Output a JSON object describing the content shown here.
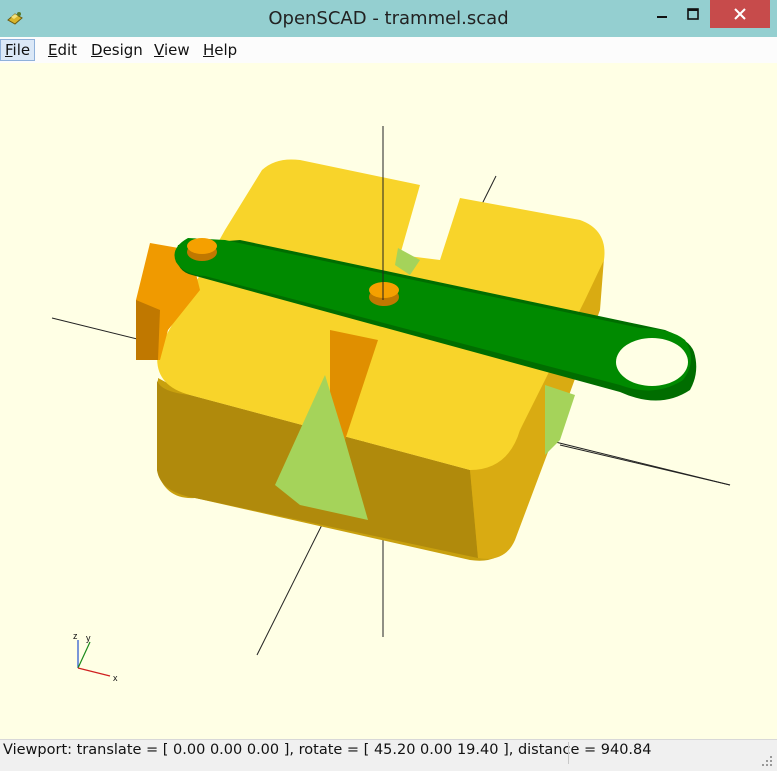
{
  "window": {
    "title": "OpenSCAD - trammel.scad"
  },
  "menu": {
    "items": [
      {
        "label": "File",
        "key": "F",
        "rest": "ile"
      },
      {
        "label": "Edit",
        "key": "E",
        "rest": "dit"
      },
      {
        "label": "Design",
        "key": "D",
        "rest": "esign"
      },
      {
        "label": "View",
        "key": "V",
        "rest": "iew"
      },
      {
        "label": "Help",
        "key": "H",
        "rest": "elp"
      }
    ]
  },
  "axes_gizmo": {
    "z": "z",
    "y": "y",
    "x": "x"
  },
  "status": {
    "text": "Viewport: translate = [ 0.00 0.00 0.00 ], rotate = [ 45.20 0.00 19.40 ], distance = 940.84"
  },
  "colors": {
    "titlebar": "#94cfd0",
    "close": "#c74b4b",
    "background": "#ffffe5",
    "part_yellow": "#f9d423",
    "part_side": "#d0a20f",
    "part_orange": "#f5a000",
    "arm_green": "#008a00",
    "cutout_green": "#a3d65c"
  }
}
